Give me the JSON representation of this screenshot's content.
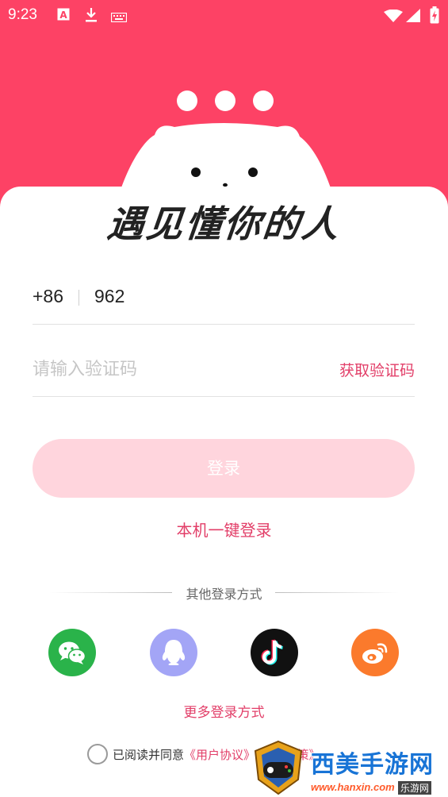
{
  "status_bar": {
    "time": "9:23",
    "icons_left": [
      "app-badge-icon",
      "download-icon",
      "keyboard-icon"
    ],
    "icons_right": [
      "wifi-icon",
      "signal-icon",
      "battery-charging-icon"
    ]
  },
  "header": {
    "slogan": "遇见懂你的人",
    "colors": {
      "accent": "#fd4265",
      "link": "#e23e68"
    }
  },
  "form": {
    "country_code": "+86",
    "phone_value": "962",
    "code_placeholder": "请输入验证码",
    "get_code_label": "获取验证码",
    "login_label": "登录",
    "one_key_label": "本机一键登录"
  },
  "other_login": {
    "label": "其他登录方式",
    "providers": [
      {
        "name": "wechat",
        "icon": "wechat-icon",
        "color": "#2ab34a"
      },
      {
        "name": "qq",
        "icon": "qq-icon",
        "color": "#a3a5f6"
      },
      {
        "name": "tiktok",
        "icon": "tiktok-icon",
        "color": "#111111"
      },
      {
        "name": "weibo",
        "icon": "weibo-icon",
        "color": "#fb7a2c"
      }
    ],
    "more_label": "更多登录方式"
  },
  "agreement": {
    "prefix": "已阅读并同意",
    "user_agreement": "《用户协议》",
    "privacy": "《隐私政策》"
  },
  "watermark": {
    "text": "西美手游网",
    "url": "www.hanxin.com",
    "sub": "乐游网"
  }
}
